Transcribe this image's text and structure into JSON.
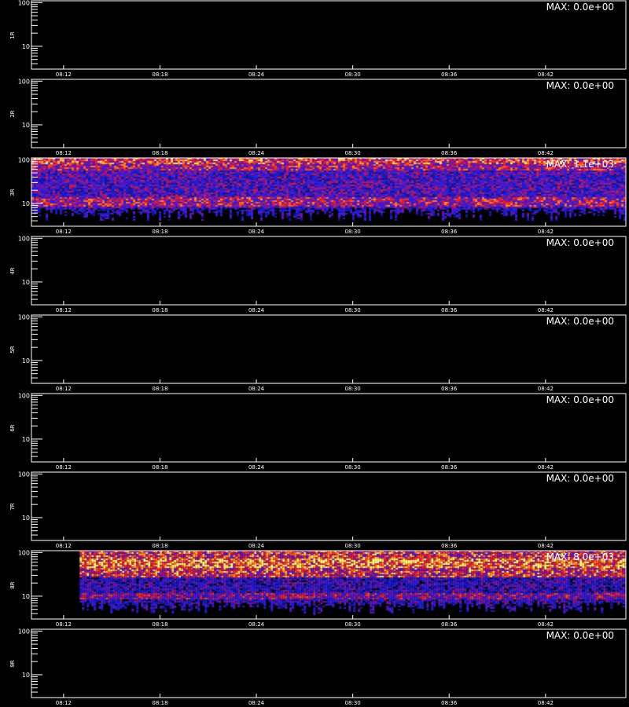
{
  "panels": [
    {
      "label": "1R",
      "max": "MAX: 0.0e+00",
      "active": false
    },
    {
      "label": "2R",
      "max": "MAX: 0.0e+00",
      "active": false
    },
    {
      "label": "3R",
      "max": "MAX: 1.1e+03",
      "active": true
    },
    {
      "label": "4R",
      "max": "MAX: 0.0e+00",
      "active": false
    },
    {
      "label": "5R",
      "max": "MAX: 0.0e+00",
      "active": false
    },
    {
      "label": "6R",
      "max": "MAX: 0.0e+00",
      "active": false
    },
    {
      "label": "7R",
      "max": "MAX: 0.0e+00",
      "active": false
    },
    {
      "label": "8R",
      "max": "MAX: 8.0e+03",
      "active": true
    },
    {
      "label": "9R",
      "max": "MAX: 0.0e+00",
      "active": false
    }
  ],
  "chart_data": {
    "type": "heatmap",
    "x_ticks": [
      "08:12",
      "08:18",
      "08:24",
      "08:30",
      "08:36",
      "08:42"
    ],
    "y_ticks": [
      10,
      100
    ],
    "y_scale": "log",
    "ylim": [
      3,
      110
    ],
    "xlim": [
      "08:10",
      "08:47"
    ],
    "colors": {
      "low": "#1a1aff",
      "mid": "#ff2020",
      "high": "#ffff60"
    },
    "panels_with_data": [
      {
        "label": "3R",
        "max_value": 1100,
        "data_start": "08:10"
      },
      {
        "label": "8R",
        "max_value": 8000,
        "data_start": "08:13"
      }
    ]
  }
}
